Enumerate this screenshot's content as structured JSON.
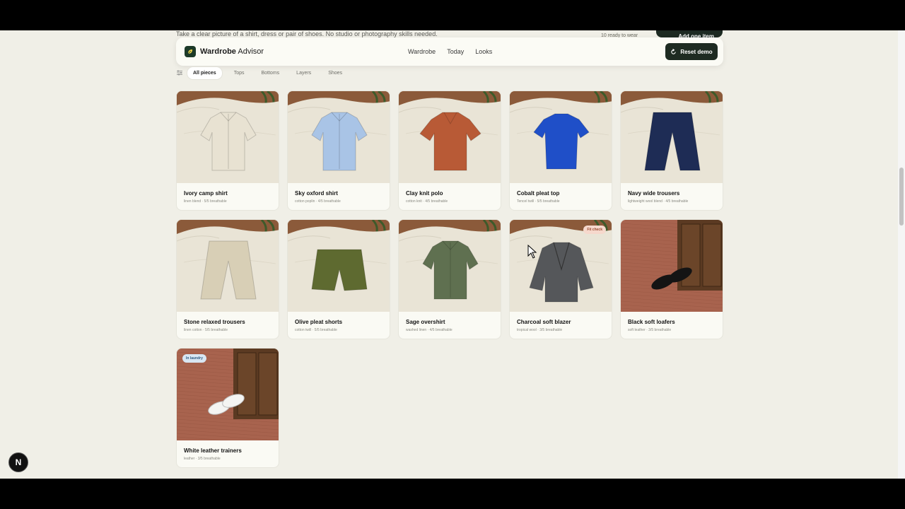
{
  "underlay": {
    "intro_text": "Take a clear picture of a shirt, dress or pair of shoes. No studio or photography skills needed.",
    "ready_text": "10 ready to wear",
    "add_button": "Add one item"
  },
  "nav": {
    "brand_bold": "Wardrobe",
    "brand_light": " Advisor",
    "links": [
      "Wardrobe",
      "Today",
      "Looks"
    ],
    "reset_label": "Reset demo"
  },
  "filters": [
    "All pieces",
    "Tops",
    "Bottoms",
    "Layers",
    "Shoes"
  ],
  "items": [
    {
      "name": "Ivory camp shirt",
      "meta": "linen blend · 5/5 breathable",
      "kind": "shirt",
      "color": "#e8e2d2",
      "scene": "bed"
    },
    {
      "name": "Sky oxford shirt",
      "meta": "cotton poplin · 4/5 breathable",
      "kind": "shirt",
      "color": "#a9c4e6",
      "scene": "bed"
    },
    {
      "name": "Clay knit polo",
      "meta": "cotton knit · 4/5 breathable",
      "kind": "polo",
      "color": "#b85a36",
      "scene": "bed"
    },
    {
      "name": "Cobalt pleat top",
      "meta": "Tencel twill · 5/5 breathable",
      "kind": "tee",
      "color": "#1f4fc8",
      "scene": "bed"
    },
    {
      "name": "Navy wide trousers",
      "meta": "lightweight wool blend · 4/5 breathable",
      "kind": "trousers",
      "color": "#1e2c55",
      "scene": "bed"
    },
    {
      "name": "Stone relaxed trousers",
      "meta": "linen cotton · 5/5 breathable",
      "kind": "trousers",
      "color": "#d8cfb6",
      "scene": "bed"
    },
    {
      "name": "Olive pleat shorts",
      "meta": "cotton twill · 5/5 breathable",
      "kind": "shorts",
      "color": "#5e6a30",
      "scene": "bed"
    },
    {
      "name": "Sage overshirt",
      "meta": "washed linen · 4/5 breathable",
      "kind": "shirt",
      "color": "#5f7050",
      "scene": "bed"
    },
    {
      "name": "Charcoal soft blazer",
      "meta": "tropical wool · 3/5 breathable",
      "kind": "blazer",
      "color": "#55575a",
      "scene": "bed",
      "badge": "Fit check",
      "badge_color": "#f6d8cc",
      "badge_text": "#9a4a30"
    },
    {
      "name": "Black soft loafers",
      "meta": "soft leather · 3/5 breathable",
      "kind": "loafers",
      "color": "#141414",
      "scene": "floor"
    },
    {
      "name": "White leather trainers",
      "meta": "leather · 3/5 breathable",
      "kind": "trainers",
      "color": "#f4f4f2",
      "scene": "floor",
      "badge": "In laundry",
      "badge_color": "#d8e6f2",
      "badge_text": "#2f5a80"
    }
  ],
  "next_badge": "N"
}
